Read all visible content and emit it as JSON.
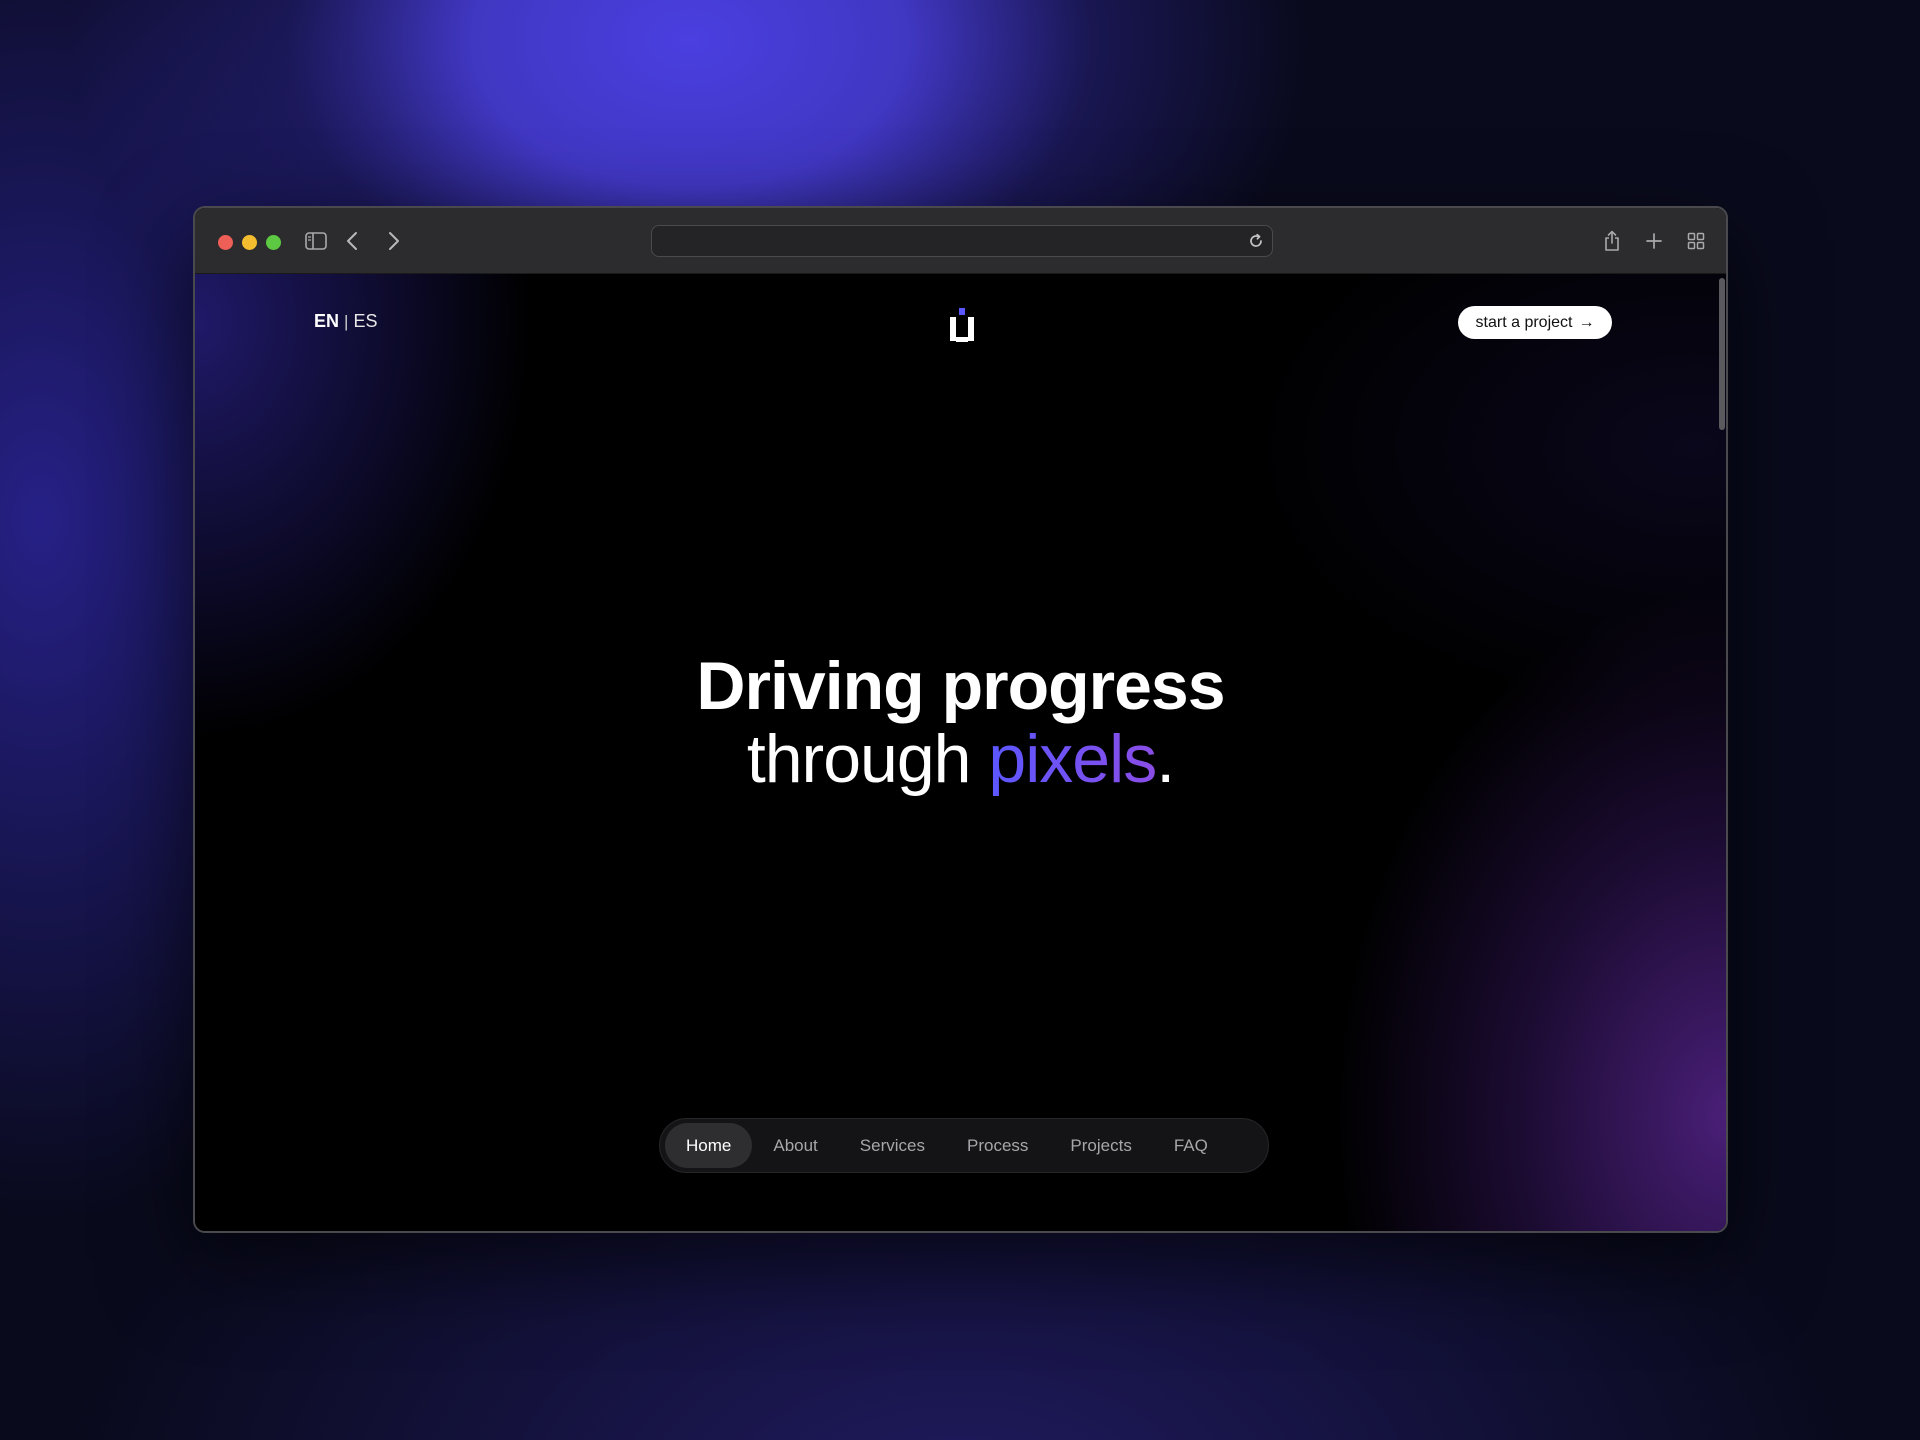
{
  "browser": {
    "address_bar_value": "",
    "toolbar_icons": [
      "sidebar-icon",
      "back-chevron-icon",
      "forward-chevron-icon",
      "reload-icon",
      "share-icon",
      "plus-icon",
      "tab-overview-icon"
    ]
  },
  "header": {
    "lang_active": "EN",
    "lang_separator": "|",
    "lang_other": "ES",
    "cta_label": "start a project",
    "cta_arrow": "→"
  },
  "hero": {
    "line1": "Driving progress",
    "line2_prefix": "through ",
    "line2_accent": "pixels",
    "line2_suffix": "."
  },
  "nav": {
    "items": [
      {
        "label": "Home",
        "active": true
      },
      {
        "label": "About",
        "active": false
      },
      {
        "label": "Services",
        "active": false
      },
      {
        "label": "Process",
        "active": false
      },
      {
        "label": "Projects",
        "active": false
      },
      {
        "label": "FAQ",
        "active": false
      }
    ]
  },
  "colors": {
    "accent_start": "#5b57ff",
    "accent_end": "#8a4de6",
    "logo_dot": "#5b57ff"
  }
}
